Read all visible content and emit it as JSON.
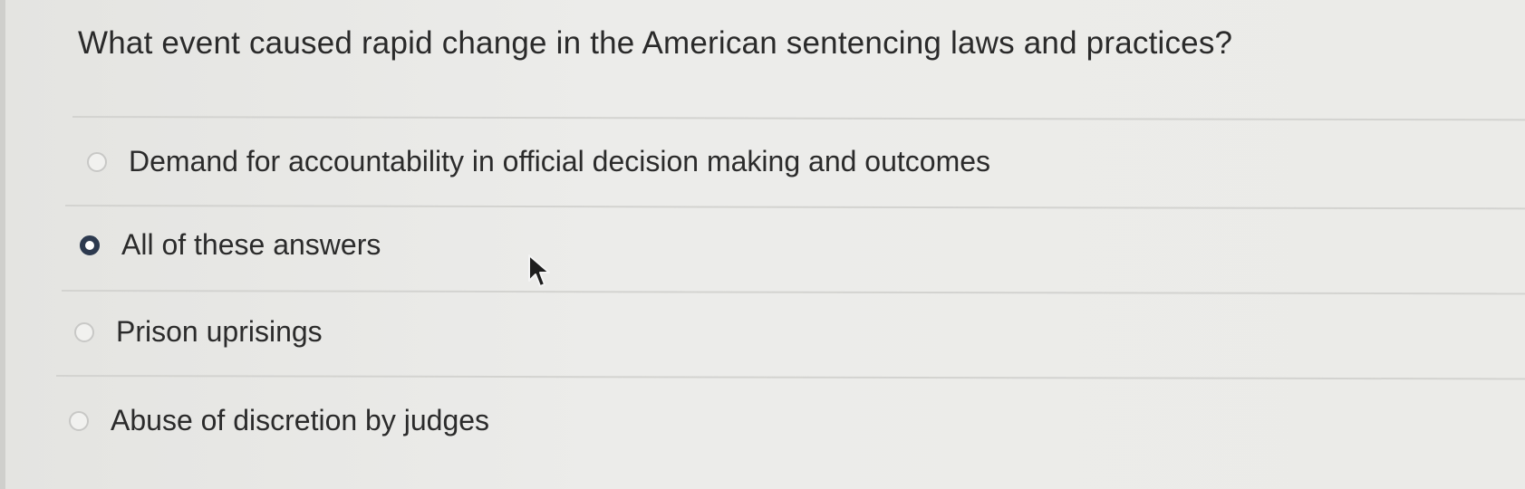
{
  "question": {
    "text": "What event caused rapid change in the American sentencing laws and practices?"
  },
  "options": [
    {
      "label": "Demand for accountability in official decision making and outcomes",
      "selected": false
    },
    {
      "label": "All of these answers",
      "selected": true
    },
    {
      "label": "Prison uprisings",
      "selected": false
    },
    {
      "label": "Abuse of discretion by judges",
      "selected": false
    }
  ],
  "colors": {
    "background": "#e9e9e6",
    "text": "#2b2b2b",
    "divider": "#d3d3d0",
    "radio_selected": "#2d3a4f"
  },
  "icons": {
    "cursor": "mouse-pointer-arrow-icon"
  }
}
